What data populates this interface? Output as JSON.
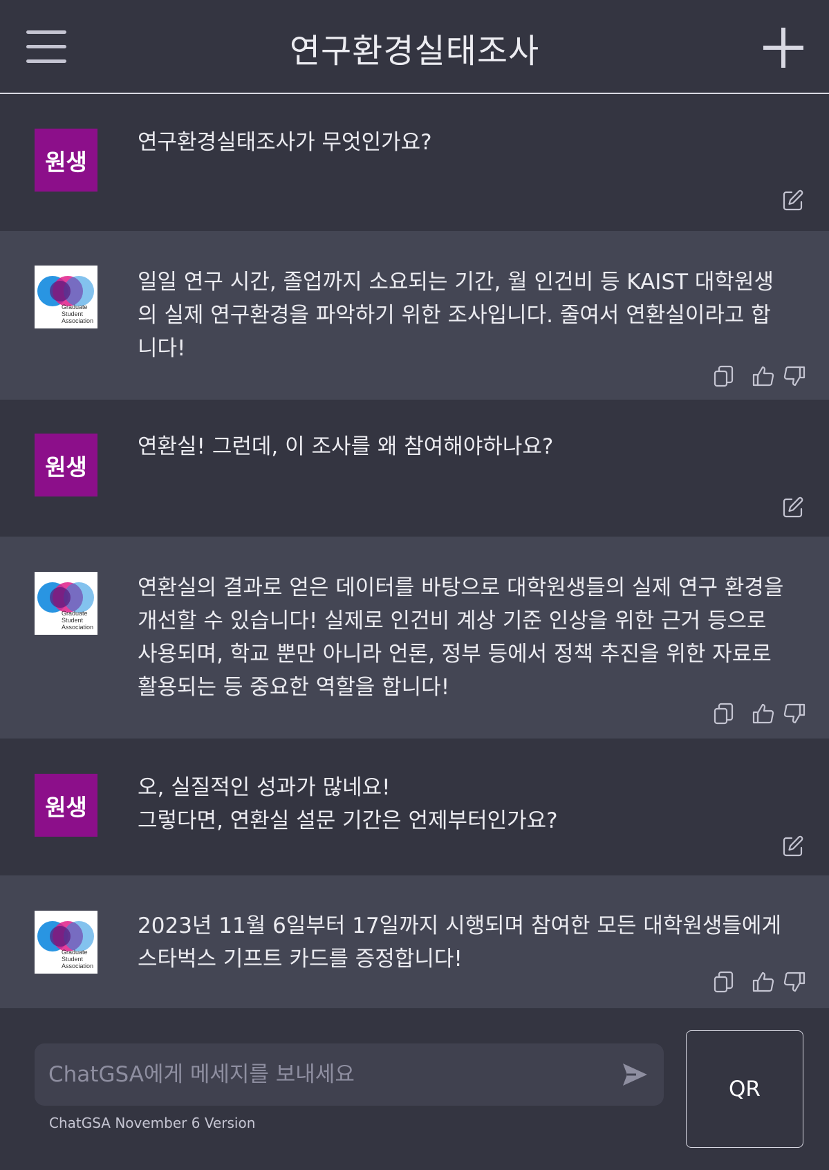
{
  "header": {
    "title": "연구환경실태조사",
    "menu_icon": "hamburger-menu-icon",
    "new_chat_icon": "plus-icon"
  },
  "colors": {
    "background": "#343541",
    "bot_message_background": "#444654",
    "user_avatar": "#8c0f8a",
    "input_background": "#40414f"
  },
  "messages": [
    {
      "role": "user",
      "avatar_label": "원생",
      "text": "연구환경실태조사가 무엇인가요?",
      "actions": [
        "edit-icon"
      ]
    },
    {
      "role": "bot",
      "avatar_label": "Graduate\nStudent\nAssociation",
      "text": "일일 연구 시간, 졸업까지 소요되는 기간, 월 인건비 등 KAIST 대학원생\n의 실제 연구환경을 파악하기 위한 조사입니다. 줄여서 연환실이라고 합\n니다!",
      "actions": [
        "copy-icon",
        "thumbs-up-icon",
        "thumbs-down-icon"
      ]
    },
    {
      "role": "user",
      "avatar_label": "원생",
      "text": "연환실! 그런데, 이 조사를 왜 참여해야하나요?",
      "actions": [
        "edit-icon"
      ]
    },
    {
      "role": "bot",
      "avatar_label": "Graduate\nStudent\nAssociation",
      "text": "연환실의 결과로 얻은 데이터를 바탕으로 대학원생들의 실제 연구 환경을\n개선할 수 있습니다! 실제로 인건비 계상 기준 인상을 위한 근거 등으로\n사용되며, 학교 뿐만 아니라 언론, 정부 등에서 정책 추진을 위한 자료로\n활용되는 등 중요한 역할을 합니다!",
      "actions": [
        "copy-icon",
        "thumbs-up-icon",
        "thumbs-down-icon"
      ]
    },
    {
      "role": "user",
      "avatar_label": "원생",
      "text": "오, 실질적인 성과가 많네요!\n그렇다면, 연환실 설문 기간은 언제부터인가요?",
      "actions": [
        "edit-icon"
      ]
    },
    {
      "role": "bot",
      "avatar_label": "Graduate\nStudent\nAssociation",
      "text": "2023년 11월 6일부터 17일까지 시행되며 참여한 모든 대학원생들에게\n스타벅스 기프트 카드를 증정합니다!",
      "actions": [
        "copy-icon",
        "thumbs-up-icon",
        "thumbs-down-icon"
      ]
    }
  ],
  "composer": {
    "placeholder": "ChatGSA에게 메세지를 보내세요",
    "send_icon": "send-icon",
    "version_text": "ChatGSA November 6 Version",
    "qr_label": "QR"
  }
}
